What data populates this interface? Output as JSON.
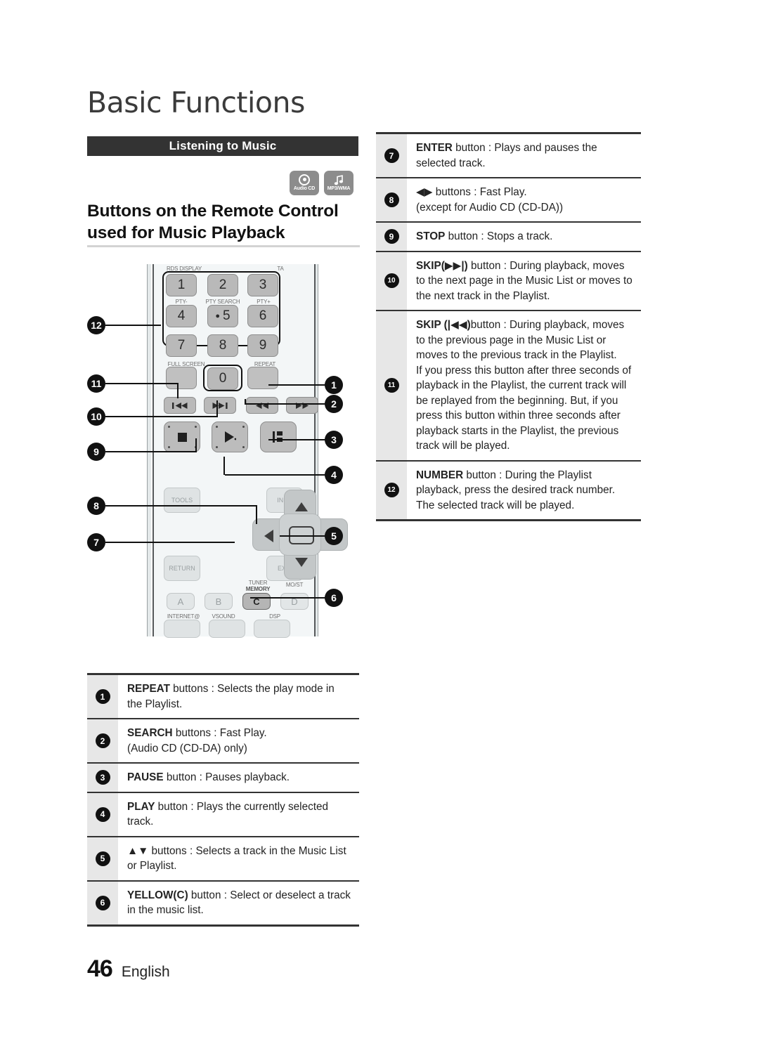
{
  "chapter": {
    "title": "Basic Functions"
  },
  "section": {
    "label": "Listening to Music"
  },
  "badges": [
    {
      "icon": "audio-cd-disc-icon",
      "caption": "Audio CD"
    },
    {
      "icon": "music-note-icon",
      "caption": "MP3/WMA"
    }
  ],
  "heading": {
    "line1": "Buttons on the Remote Control",
    "line2": "used for Music Playback"
  },
  "remote": {
    "keypad": {
      "keys": [
        "1",
        "2",
        "3",
        "4",
        "5",
        "6",
        "7",
        "8",
        "9",
        "0"
      ],
      "labels": {
        "rds": "RDS DISPLAY",
        "ta": "TA",
        "pty_minus": "PTY-",
        "pty_search": "PTY SEARCH",
        "pty_plus": "PTY+",
        "full_screen": "FULL SCREEN",
        "repeat": "REPEAT"
      }
    },
    "transport": {
      "skip_prev": "◀◀|",
      "skip_next": "|▶▶",
      "search_back": "◀◀",
      "search_fwd": "▶▶",
      "stop": "■",
      "play": "▶",
      "pause": "‖"
    },
    "nav": {
      "tools": "TOOLS",
      "info": "INFO",
      "return": "RETURN",
      "exit": "EXIT"
    },
    "color_buttons": {
      "a": "A",
      "b": "B",
      "c": "C",
      "d": "D",
      "tuner": "TUNER",
      "memory": "MEMORY",
      "most": "MO/ST",
      "internet": "INTERNET@",
      "vsound": "VSOUND",
      "dsp": "DSP"
    },
    "callouts_left": [
      "12",
      "11",
      "10",
      "9",
      "8",
      "7"
    ],
    "callouts_right": [
      "1",
      "2",
      "3",
      "4",
      "5",
      "6"
    ]
  },
  "table_right": [
    {
      "n": "7",
      "bold": "ENTER",
      "text": " button : Plays and pauses the selected track."
    },
    {
      "n": "8",
      "bold": "◀▶",
      "text": " buttons : Fast Play.\n(except for Audio CD (CD-DA))"
    },
    {
      "n": "9",
      "bold": "STOP",
      "text": " button : Stops a track."
    },
    {
      "n": "10",
      "bold": "SKIP(▶▶|)",
      "text": " button : During playback, moves to the next page in the Music List or moves to the next track in the Playlist."
    },
    {
      "n": "11",
      "bold": "SKIP (|◀◀)",
      "text": "button : During playback, moves to the previous page in the Music List or moves to the previous track in the Playlist.\nIf you press this button after three seconds of playback in the Playlist, the current track will be replayed from the beginning. But, if you press this button within three seconds after playback starts in the Playlist, the previous track will be played."
    },
    {
      "n": "12",
      "bold": "NUMBER",
      "text": " button : During the Playlist playback, press the desired track number. The selected track will be played."
    }
  ],
  "table_left": [
    {
      "n": "1",
      "bold": "REPEAT",
      "text": " buttons : Selects the play mode in the Playlist."
    },
    {
      "n": "2",
      "bold": "SEARCH",
      "text": " buttons : Fast Play.\n(Audio CD (CD-DA) only)"
    },
    {
      "n": "3",
      "bold": "PAUSE",
      "text": " button : Pauses playback."
    },
    {
      "n": "4",
      "bold": "PLAY",
      "text": " button : Plays the currently selected track."
    },
    {
      "n": "5",
      "bold": "▲▼",
      "text": " buttons : Selects a track in the Music List or Playlist."
    },
    {
      "n": "6",
      "bold": "YELLOW(C)",
      "text": " button : Select or deselect a track in the music list."
    }
  ],
  "footer": {
    "page": "46",
    "language": "English"
  },
  "colors": {
    "bar_bg": "#333333",
    "badge_bg": "#8c8c8c",
    "index_bg": "#e7e7e7",
    "rule": "#d3d3d3"
  }
}
